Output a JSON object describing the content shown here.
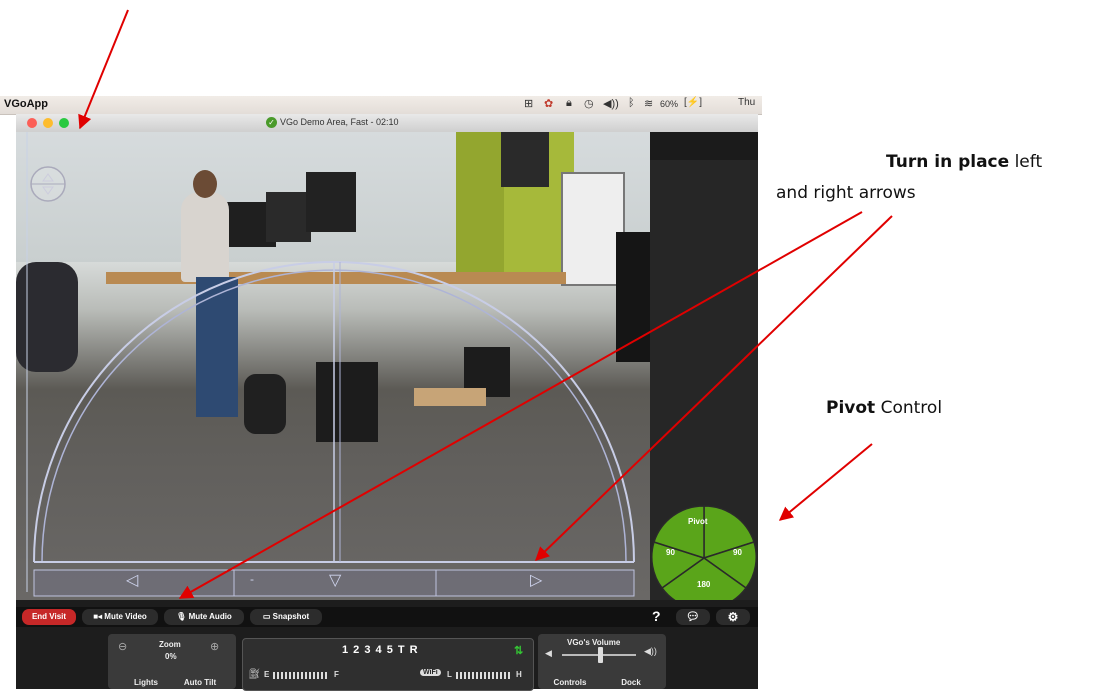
{
  "menubar": {
    "app_name": "VGoApp",
    "battery": "60%",
    "clock": "Thu"
  },
  "window": {
    "title": "VGo Demo Area, Fast - 02:10"
  },
  "overlay": {
    "left_arrow": "◁",
    "center_dash": "-",
    "down_arrow": "▽",
    "right_arrow": "▷"
  },
  "pivot": {
    "title": "Pivot",
    "left": "90",
    "right": "90",
    "bottom": "180"
  },
  "toolbar": {
    "end_visit": "End Visit",
    "mute_video": "Mute Video",
    "mute_audio": "Mute Audio",
    "snapshot": "Snapshot",
    "help": "?"
  },
  "controls": {
    "zoom_label": "Zoom",
    "zoom_value": "0%",
    "lights": "Lights",
    "auto_tilt": "Auto Tilt",
    "gears": "1 2 3 4 5 T R",
    "battery_e": "E",
    "battery_f": "F",
    "wifi": "WiFi",
    "wifi_l": "L",
    "wifi_h": "H",
    "volume_label": "VGo's Volume",
    "controls_btn": "Controls",
    "dock_btn": "Dock"
  },
  "annotations": {
    "turn_bold": "Turn in place",
    "turn_rest": " left",
    "turn_line2": "and right arrows",
    "pivot_bold": "Pivot",
    "pivot_rest": " Control"
  },
  "colors": {
    "end_visit": "#c62828",
    "pivot_green": "#5aa51a",
    "arrow_red": "#e00000",
    "gear_green": "#34c534"
  }
}
